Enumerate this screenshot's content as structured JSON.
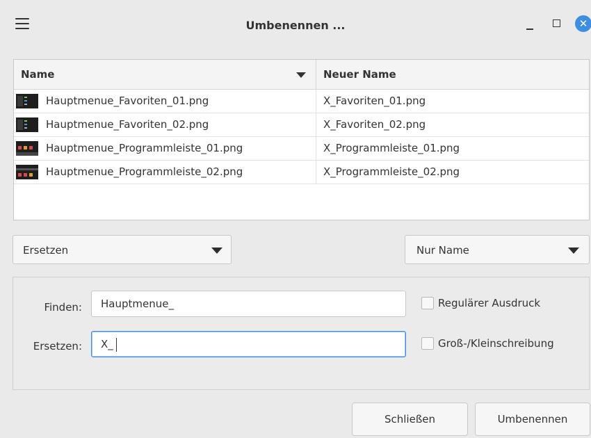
{
  "window": {
    "title": "Umbenennen ..."
  },
  "table": {
    "columns": {
      "name": "Name",
      "new_name": "Neuer Name"
    },
    "rows": [
      {
        "name": "Hauptmenue_Favoriten_01.png",
        "new_name": "X_Favoriten_01.png"
      },
      {
        "name": "Hauptmenue_Favoriten_02.png",
        "new_name": "X_Favoriten_02.png"
      },
      {
        "name": "Hauptmenue_Programmleiste_01.png",
        "new_name": "X_Programmleiste_01.png"
      },
      {
        "name": "Hauptmenue_Programmleiste_02.png",
        "new_name": "X_Programmleiste_02.png"
      }
    ]
  },
  "mode_dropdown": {
    "selected": "Ersetzen"
  },
  "scope_dropdown": {
    "selected": "Nur Name"
  },
  "find": {
    "label": "Finden:",
    "value": "Hauptmenue_"
  },
  "replace": {
    "label": "Ersetzen:",
    "value": "X_"
  },
  "options": {
    "regex": {
      "label": "Regulärer Ausdruck",
      "checked": false
    },
    "case": {
      "label": "Groß-/Kleinschreibung",
      "checked": false
    }
  },
  "buttons": {
    "close": "Schließen",
    "rename": "Umbenennen"
  },
  "colors": {
    "accent": "#3d8ee0",
    "background": "#eaeaea"
  }
}
